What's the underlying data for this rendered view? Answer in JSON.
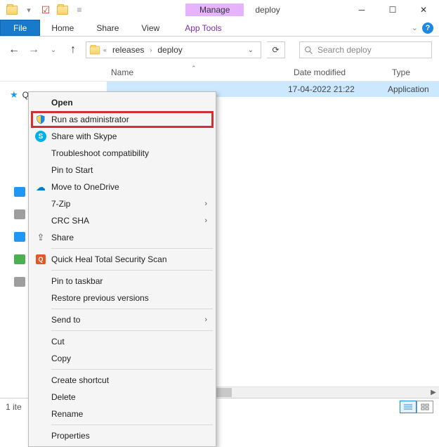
{
  "title": {
    "manage_label": "Manage",
    "window_title": "deploy",
    "app_tools_label": "App Tools"
  },
  "ribbon": {
    "file": "File",
    "home": "Home",
    "share": "Share",
    "view": "View"
  },
  "breadcrumb": {
    "seg1": "releases",
    "seg2": "deploy"
  },
  "search": {
    "placeholder": "Search deploy"
  },
  "columns": {
    "name": "Name",
    "date": "Date modified",
    "type": "Type"
  },
  "sidebar": {
    "quick_access": "Quick access"
  },
  "row": {
    "date": "17-04-2022 21:22",
    "type": "Application"
  },
  "context_menu": {
    "open": "Open",
    "run_admin": "Run as administrator",
    "share_skype": "Share with Skype",
    "troubleshoot": "Troubleshoot compatibility",
    "pin_start": "Pin to Start",
    "onedrive": "Move to OneDrive",
    "sevenzip": "7-Zip",
    "crcsha": "CRC SHA",
    "share": "Share",
    "quickheal": "Quick Heal Total Security Scan",
    "pin_taskbar": "Pin to taskbar",
    "restore_prev": "Restore previous versions",
    "send_to": "Send to",
    "cut": "Cut",
    "copy": "Copy",
    "create_shortcut": "Create shortcut",
    "delete": "Delete",
    "rename": "Rename",
    "properties": "Properties"
  },
  "status": {
    "items": "1 ite"
  }
}
